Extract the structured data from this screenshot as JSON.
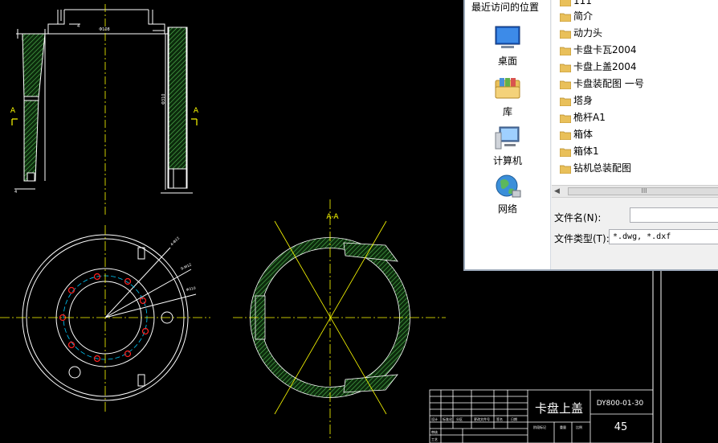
{
  "dialog": {
    "places_header": "最近访问的位置",
    "places": [
      {
        "label": "桌面",
        "icon": "desktop-icon"
      },
      {
        "label": "库",
        "icon": "library-folder-icon"
      },
      {
        "label": "计算机",
        "icon": "computer-icon"
      },
      {
        "label": "网络",
        "icon": "network-globe-icon"
      }
    ],
    "files": [
      "111",
      "简介",
      "动力头",
      "卡盘卡瓦2004",
      "卡盘上盖2004",
      "卡盘装配图  一号",
      "塔身",
      "桅杆A1",
      "箱体",
      "箱体1",
      "钻机总装配图"
    ],
    "scroll_thumb": "III",
    "filename_label": "文件名(N):",
    "filename_value": "",
    "filetype_label": "文件类型(T):",
    "filetype_value": "*.dwg, *.dxf"
  },
  "drawing": {
    "section_left_a": "A",
    "section_right_a": "A",
    "section_title": "A-A",
    "title_block": {
      "part_name": "卡盘上盖",
      "drawing_no": "DY800-01-30",
      "number": "45"
    },
    "colors": {
      "background": "#000000",
      "outline": "#ffffff",
      "centerline": "#ffff00",
      "hatch": "#2e8b2e",
      "holes": "#ff2020",
      "pitch_circle": "#00ccff"
    }
  }
}
